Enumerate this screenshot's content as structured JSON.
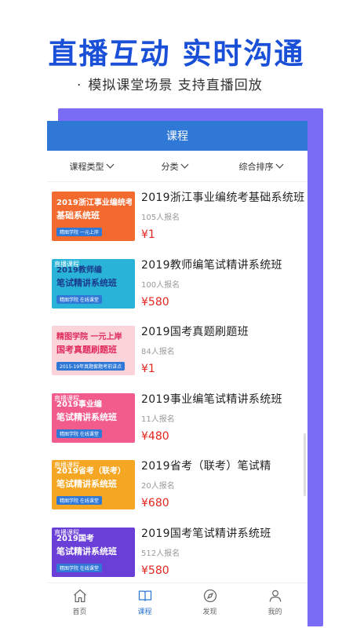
{
  "promo": {
    "title": "直播互动 实时沟通",
    "subtitle_bullet": "·",
    "subtitle": "模拟课堂场景 支持直播回放"
  },
  "header": {
    "title": "课程"
  },
  "filters": [
    {
      "label": "课程类型"
    },
    {
      "label": "分类"
    },
    {
      "label": "综合排序"
    }
  ],
  "courses": [
    {
      "title": "2019浙江事业编统考基础系统班",
      "enroll": "105人报名",
      "price": "¥1",
      "thumb_text": "2019浙江事业编统考",
      "thumb_line2": "基础系统班",
      "thumb_sub": "精图学院 一元上岸",
      "thumb_bg": "#f26a2e",
      "thumb_fg": "#ffffff"
    },
    {
      "title": "2019教师编笔试精讲系统班",
      "enroll": "100人报名",
      "price": "¥580",
      "thumb_text": "2019教师编",
      "thumb_line2": "笔试精讲系统班",
      "thumb_sub": "精图学院 在线课堂",
      "thumb_bg": "#2ab3d8",
      "thumb_fg": "#1a3a8a",
      "thumb_tag": "直播课程"
    },
    {
      "title": "2019国考真题刷题班",
      "enroll": "84人报名",
      "price": "¥1",
      "thumb_text": "精图学院 一元上岸",
      "thumb_line2": "国考真题刷题班",
      "thumb_sub": "2015-19年真题套题考前讲点",
      "thumb_bg": "#fbd4da",
      "thumb_fg": "#e02a5b"
    },
    {
      "title": "2019事业编笔试精讲系统班",
      "enroll": "11人报名",
      "price": "¥480",
      "thumb_text": "2019事业编",
      "thumb_line2": "笔试精讲系统班",
      "thumb_sub": "精图学院 在线课堂",
      "thumb_bg": "#f25c8c",
      "thumb_fg": "#ffffff",
      "thumb_tag": "直播课程"
    },
    {
      "title": "2019省考（联考）笔试精",
      "enroll": "20人报名",
      "price": "¥680",
      "thumb_text": "2019省考（联考）",
      "thumb_line2": "笔试精讲系统班",
      "thumb_sub": "精图学院 在线课堂",
      "thumb_bg": "#f5a623",
      "thumb_fg": "#ffffff",
      "thumb_tag": "直播课程"
    },
    {
      "title": "2019国考笔试精讲系统班",
      "enroll": "512人报名",
      "price": "¥580",
      "thumb_text": "2019国考",
      "thumb_line2": "笔试精讲系统班",
      "thumb_sub": "精图学院 在线课堂",
      "thumb_bg": "#6a3fd8",
      "thumb_fg": "#ffffff",
      "thumb_tag": "直播课程"
    }
  ],
  "nav": [
    {
      "label": "首页",
      "icon": "home-icon"
    },
    {
      "label": "课程",
      "icon": "book-icon",
      "active": true
    },
    {
      "label": "发现",
      "icon": "compass-icon"
    },
    {
      "label": "我的",
      "icon": "user-icon"
    }
  ],
  "colors": {
    "brand_blue": "#1a4fd8",
    "header_blue": "#2f78d6",
    "price_red": "#e5261f",
    "shadow_purple": "#7b6cf5"
  }
}
